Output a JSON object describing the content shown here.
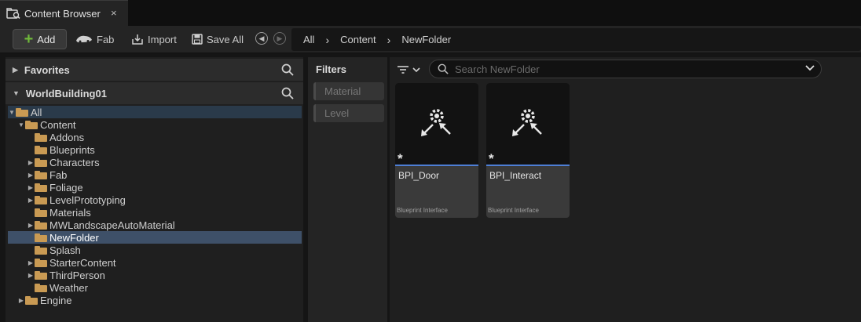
{
  "tab": {
    "title": "Content Browser",
    "close": "×",
    "icon": "content-browser-icon"
  },
  "toolbar": {
    "add_label": "Add",
    "fab_label": "Fab",
    "import_label": "Import",
    "save_all_label": "Save All"
  },
  "breadcrumb": [
    "All",
    "Content",
    "NewFolder"
  ],
  "sources": {
    "favorites_label": "Favorites",
    "project_label": "WorldBuilding01",
    "tree": [
      {
        "label": "All",
        "level": 0,
        "arrow": "▼",
        "selected": false,
        "soft": true
      },
      {
        "label": "Content",
        "level": 1,
        "arrow": "▼",
        "selected": false,
        "soft": false
      },
      {
        "label": "Addons",
        "level": 2,
        "arrow": "",
        "selected": false,
        "soft": false
      },
      {
        "label": "Blueprints",
        "level": 2,
        "arrow": "",
        "selected": false,
        "soft": false
      },
      {
        "label": "Characters",
        "level": 2,
        "arrow": "▶",
        "selected": false,
        "soft": false
      },
      {
        "label": "Fab",
        "level": 2,
        "arrow": "▶",
        "selected": false,
        "soft": false
      },
      {
        "label": "Foliage",
        "level": 2,
        "arrow": "▶",
        "selected": false,
        "soft": false
      },
      {
        "label": "LevelPrototyping",
        "level": 2,
        "arrow": "▶",
        "selected": false,
        "soft": false
      },
      {
        "label": "Materials",
        "level": 2,
        "arrow": "",
        "selected": false,
        "soft": false
      },
      {
        "label": "MWLandscapeAutoMaterial",
        "level": 2,
        "arrow": "▶",
        "selected": false,
        "soft": false
      },
      {
        "label": "NewFolder",
        "level": 2,
        "arrow": "",
        "selected": true,
        "soft": false
      },
      {
        "label": "Splash",
        "level": 2,
        "arrow": "",
        "selected": false,
        "soft": false
      },
      {
        "label": "StarterContent",
        "level": 2,
        "arrow": "▶",
        "selected": false,
        "soft": false
      },
      {
        "label": "ThirdPerson",
        "level": 2,
        "arrow": "▶",
        "selected": false,
        "soft": false
      },
      {
        "label": "Weather",
        "level": 2,
        "arrow": "",
        "selected": false,
        "soft": false
      },
      {
        "label": "Engine",
        "level": 1,
        "arrow": "▶",
        "selected": false,
        "soft": false
      }
    ]
  },
  "filters": {
    "title": "Filters",
    "chips": [
      "Material",
      "Level"
    ]
  },
  "search": {
    "placeholder": "Search NewFolder"
  },
  "assets": [
    {
      "name": "BPI_Door",
      "type": "Blueprint Interface",
      "icon": "blueprint-interface-icon"
    },
    {
      "name": "BPI_Interact",
      "type": "Blueprint Interface",
      "icon": "blueprint-interface-icon"
    }
  ],
  "colors": {
    "accent": "#4e7fd6",
    "selection": "#3e5068",
    "folder": "#c99a53",
    "add_plus": "#6fb83a"
  }
}
